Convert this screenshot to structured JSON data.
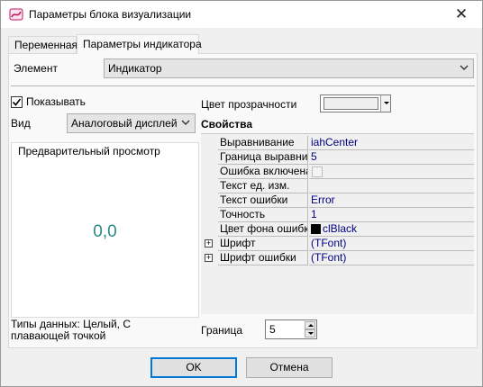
{
  "window": {
    "title": "Параметры блока визуализации",
    "close_glyph": "✕"
  },
  "tabs": [
    {
      "label": "Переменная",
      "active": false
    },
    {
      "label": "Параметры индикатора",
      "active": true
    }
  ],
  "element": {
    "label": "Элемент",
    "value": "Индикатор"
  },
  "show": {
    "label": "Показывать",
    "checked": true
  },
  "view": {
    "label": "Вид",
    "value": "Аналоговый дисплей"
  },
  "preview": {
    "title": "Предварительный просмотр",
    "value": "0,0"
  },
  "data_types": "Типы данных: Целый, С плавающей точкой",
  "transparency": {
    "label": "Цвет прозрачности",
    "color": "#f0f0f0"
  },
  "properties": {
    "title": "Свойства",
    "rows": [
      {
        "name": "Выравнивание",
        "value": "iahCenter"
      },
      {
        "name": "Граница выравнива",
        "value": "5"
      },
      {
        "name": "Ошибка включена",
        "value": "",
        "checkbox": true
      },
      {
        "name": "Текст ед. изм.",
        "value": ""
      },
      {
        "name": "Текст ошибки",
        "value": "Error"
      },
      {
        "name": "Точность",
        "value": "1"
      },
      {
        "name": "Цвет фона ошибки",
        "value": "clBlack",
        "swatch": "#000000"
      },
      {
        "name": "Шрифт",
        "value": "(TFont)",
        "expandable": true
      },
      {
        "name": "Шрифт ошибки",
        "value": "(TFont)",
        "expandable": true
      }
    ]
  },
  "border": {
    "label": "Граница",
    "value": "5"
  },
  "buttons": {
    "ok": "OK",
    "cancel": "Отмена"
  },
  "icons": {
    "app": "app-icon",
    "close": "close-icon",
    "dropdown": "chevron-down-icon",
    "spin_up": "spin-up-icon",
    "spin_down": "spin-down-icon"
  },
  "colors": {
    "accent": "#0078d7",
    "value_text": "#00007f",
    "preview_value": "#2a8b8b"
  }
}
